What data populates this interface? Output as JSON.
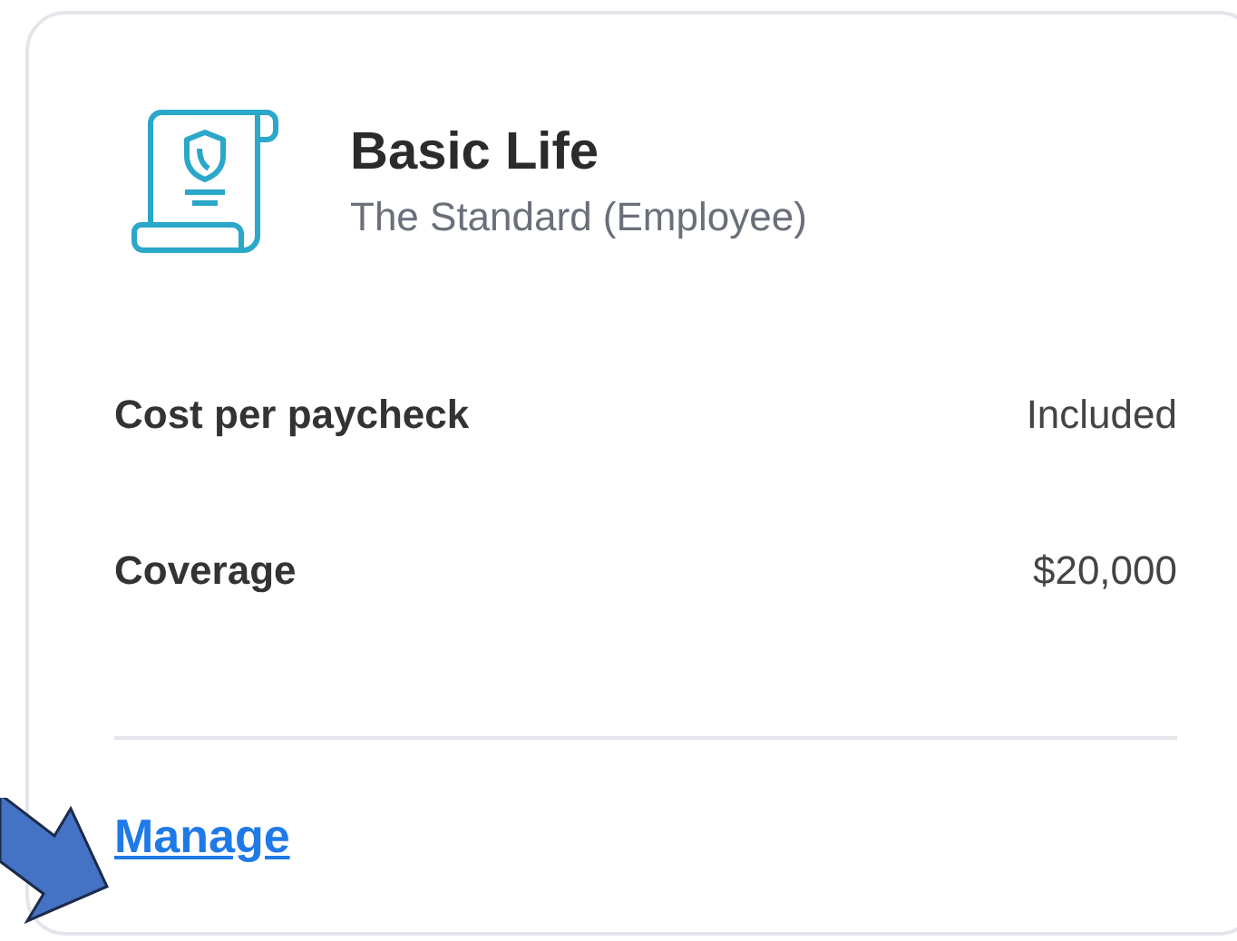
{
  "plan": {
    "title": "Basic Life",
    "provider": "The Standard (Employee)"
  },
  "details": [
    {
      "label": "Cost per paycheck",
      "value": "Included"
    },
    {
      "label": "Coverage",
      "value": "$20,000"
    }
  ],
  "action": {
    "label": "Manage"
  }
}
